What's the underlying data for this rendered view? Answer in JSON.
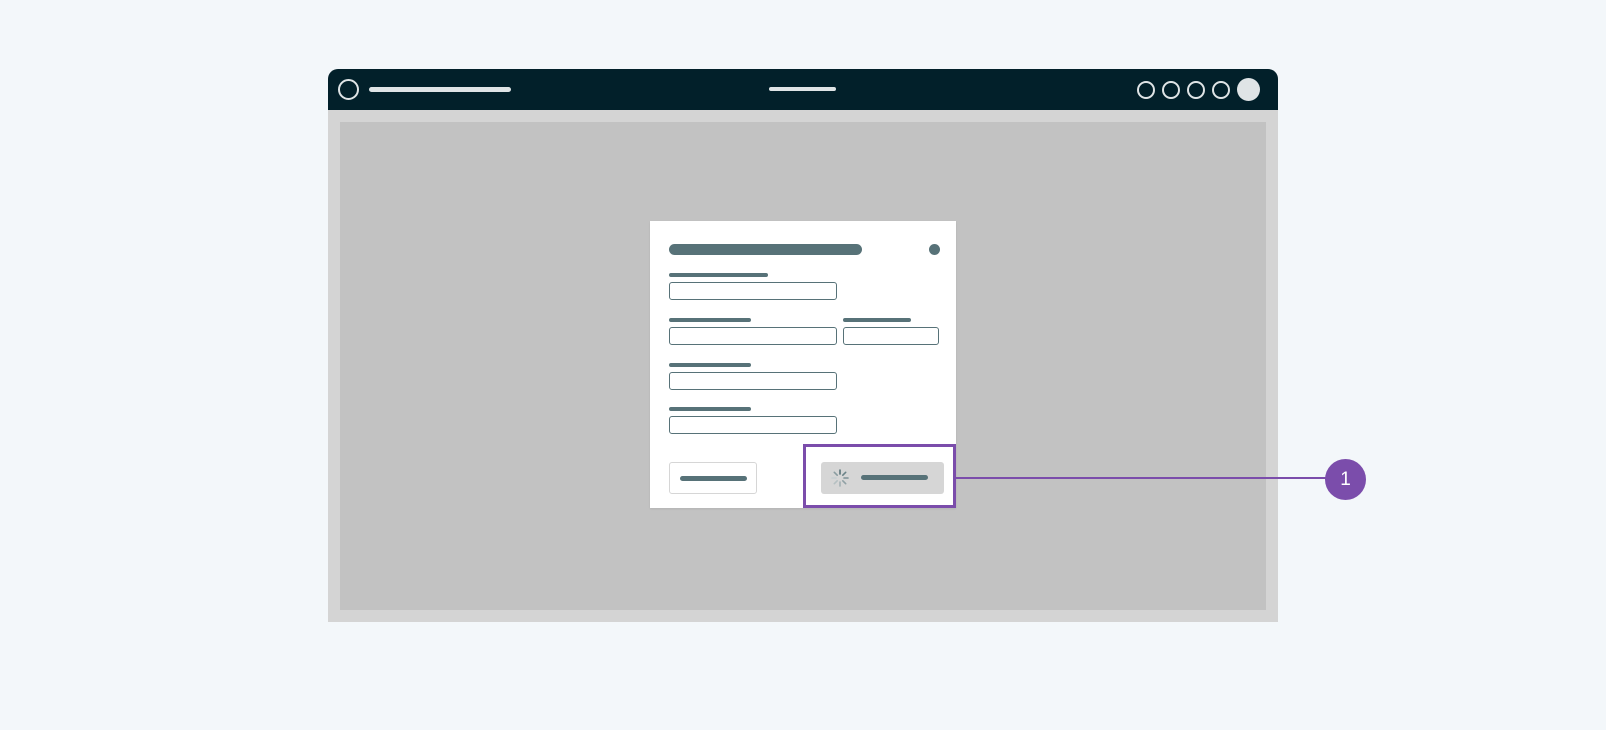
{
  "annotations": [
    {
      "label": "1",
      "target": "primary-button-loading"
    }
  ],
  "colors": {
    "page_background": "#f3f7fa",
    "topbar": "#02202a",
    "placeholder_bar": "#577278",
    "overlay": "#c2c2c2",
    "annotation_accent": "#7b4dab",
    "button_disabled": "#d6d6d6"
  },
  "icons": {
    "app_logo": "circle-outline-icon",
    "toolbar": [
      "circle-outline-icon",
      "circle-outline-icon",
      "circle-outline-icon",
      "circle-outline-icon"
    ],
    "profile": "avatar-icon",
    "dialog_close": "close-icon",
    "loading": "spinner-icon"
  },
  "state": {
    "primary_button": "loading"
  }
}
